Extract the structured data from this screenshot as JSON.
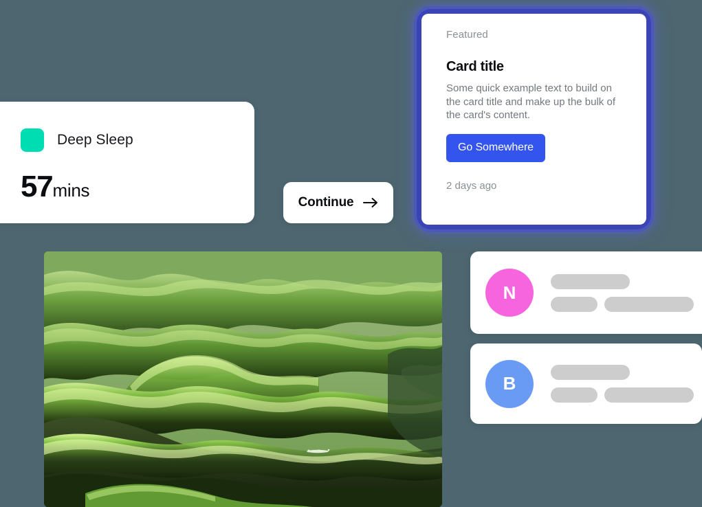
{
  "page": {
    "background_color": "#4d6670"
  },
  "stat_card": {
    "swatch_color": "#00ddb3",
    "label": "Deep Sleep",
    "value": "57",
    "unit": "mins"
  },
  "continue_button": {
    "label": "Continue",
    "icon": "arrow-right-icon"
  },
  "featured_card": {
    "eyebrow": "Featured",
    "title": "Card title",
    "body": "Some quick example text to build on the card title and make up the bulk of the card's content.",
    "action_label": "Go Somewhere",
    "action_color": "#3355ee",
    "meta": "2 days ago",
    "glow_color": "#3a44b4"
  },
  "photo": {
    "alt": "Aerial view of lush green rolling hills with sunlit ridges and dark shadowed valleys"
  },
  "people": [
    {
      "initial": "N",
      "avatar_color": "#f765de",
      "skeleton": {
        "line1": "long",
        "line2a": "short",
        "line2b": "mid"
      }
    },
    {
      "initial": "B",
      "avatar_color": "#6a9bf4",
      "skeleton": {
        "line1": "long",
        "line2a": "short",
        "line2b": "mid"
      }
    }
  ]
}
